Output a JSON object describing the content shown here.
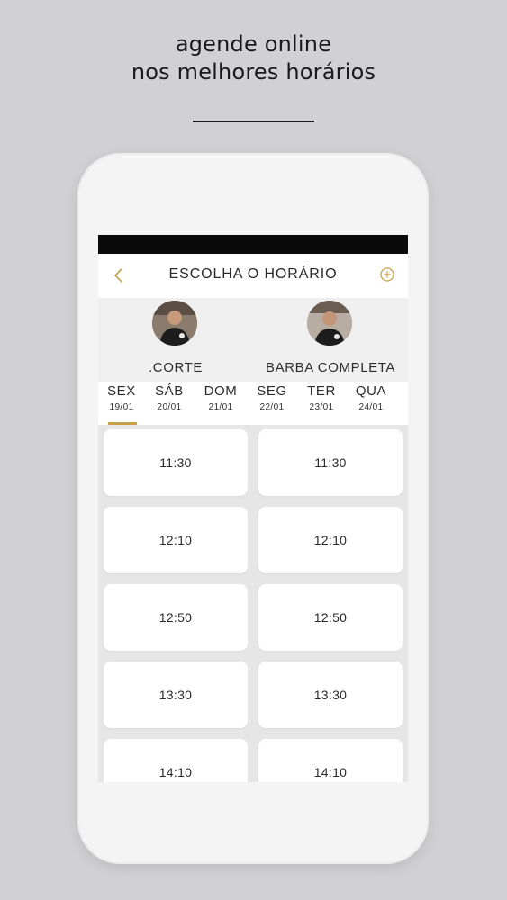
{
  "promo": {
    "line1": "agende online",
    "line2": "nos melhores horários"
  },
  "nav": {
    "back_icon": "chevron-left-icon",
    "title": "ESCOLHA O HORÁRIO",
    "add_icon": "plus-circle-icon",
    "accent_color": "#c9a14a"
  },
  "professionals": [
    {
      "name": ".CORTE"
    },
    {
      "name": "BARBA COMPLETA"
    }
  ],
  "days": [
    {
      "name": "SEX",
      "date": "19/01",
      "selected": true
    },
    {
      "name": "SÁB",
      "date": "20/01"
    },
    {
      "name": "DOM",
      "date": "21/01"
    },
    {
      "name": "SEG",
      "date": "22/01"
    },
    {
      "name": "TER",
      "date": "23/01"
    },
    {
      "name": "QUA",
      "date": "24/01"
    }
  ],
  "slots": {
    "left": [
      "11:30",
      "12:10",
      "12:50",
      "13:30",
      "14:10"
    ],
    "right": [
      "11:30",
      "12:10",
      "12:50",
      "13:30",
      "14:10"
    ]
  }
}
